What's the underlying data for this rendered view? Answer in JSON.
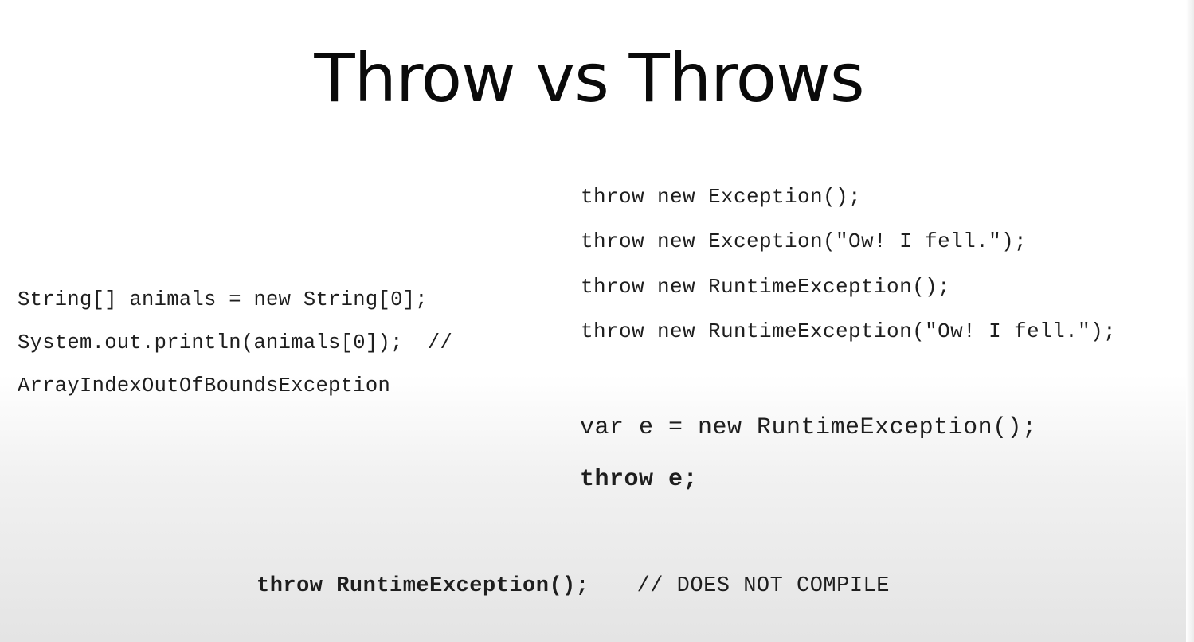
{
  "slide": {
    "title": "Throw vs Throws"
  },
  "left_code": {
    "lines": [
      "String[] animals = new String[0];",
      "System.out.println(animals[0]);  //",
      "ArrayIndexOutOfBoundsException"
    ]
  },
  "right_code": {
    "throw_lines": [
      "throw new Exception();",
      "throw new Exception(\"Ow! I fell.\");",
      "throw new RuntimeException();",
      "throw new RuntimeException(\"Ow! I fell.\");"
    ],
    "var_line": "var e = new RuntimeException();",
    "throw_e_line": "throw e;"
  },
  "bottom_code": {
    "statement": "throw RuntimeException();",
    "comment": "// DOES NOT COMPILE"
  }
}
